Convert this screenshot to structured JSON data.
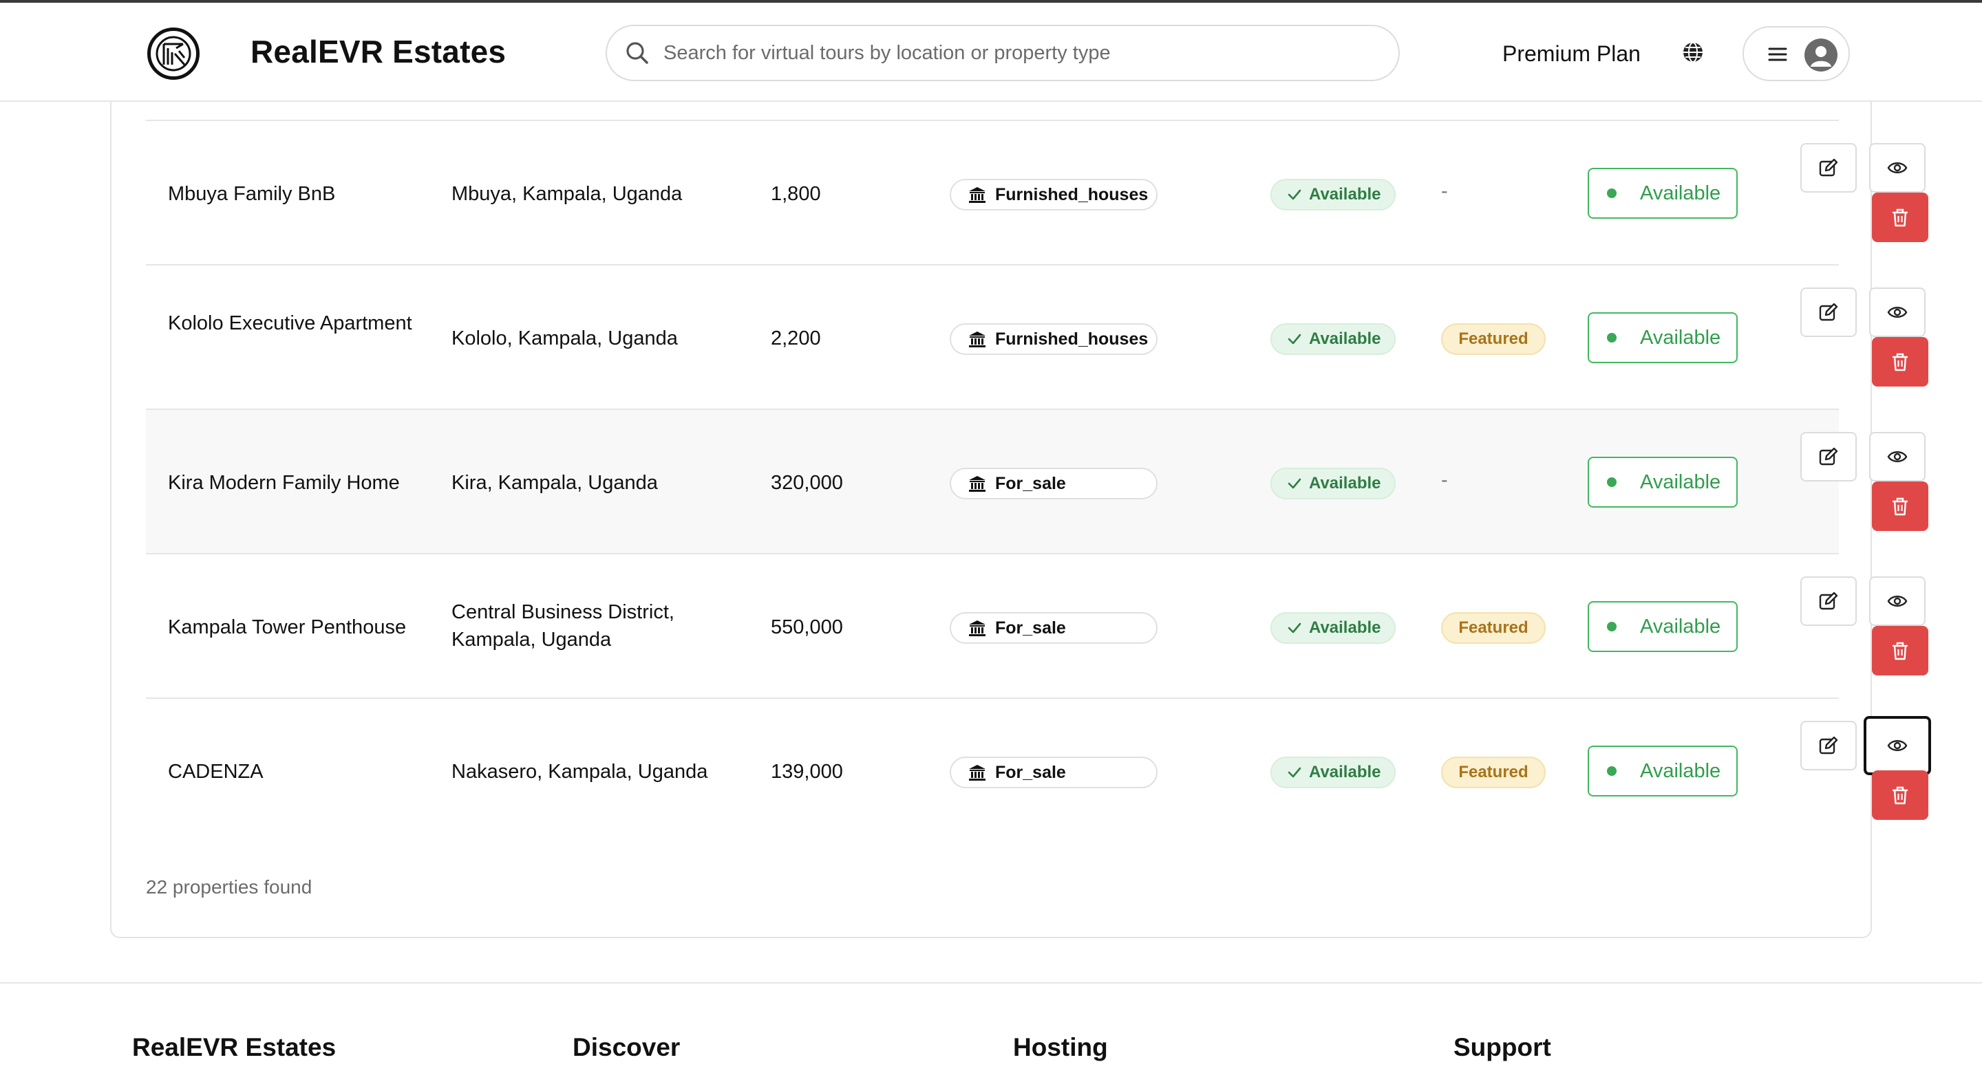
{
  "app": {
    "brand": "RealEVR Estates",
    "search_placeholder": "Search for virtual tours by location or property type",
    "plan_label": "Premium Plan"
  },
  "properties": [
    {
      "name": "Mbuya Family BnB",
      "location": "Mbuya, Kampala, Uganda",
      "price": "1,800",
      "type": "Furnished_houses",
      "availability": "Available",
      "featured": "-",
      "status": "Available"
    },
    {
      "name": "Kololo Executive Apartment",
      "location": "Kololo, Kampala, Uganda",
      "price": "2,200",
      "type": "Furnished_houses",
      "availability": "Available",
      "featured": "Featured",
      "status": "Available"
    },
    {
      "name": "Kira Modern Family Home",
      "location": "Kira, Kampala, Uganda",
      "price": "320,000",
      "type": "For_sale",
      "availability": "Available",
      "featured": "-",
      "status": "Available"
    },
    {
      "name": "Kampala Tower Penthouse",
      "location": "Central Business District, Kampala, Uganda",
      "price": "550,000",
      "type": "For_sale",
      "availability": "Available",
      "featured": "Featured",
      "status": "Available"
    },
    {
      "name": "CADENZA",
      "location": "Nakasero, Kampala, Uganda",
      "price": "139,000",
      "type": "For_sale",
      "availability": "Available",
      "featured": "Featured",
      "status": "Available"
    }
  ],
  "results_count": "22 properties found",
  "footer": {
    "columns": [
      "RealEVR Estates",
      "Discover",
      "Hosting",
      "Support"
    ]
  },
  "colors": {
    "available_green": "#2f9e4c",
    "featured_amber": "#a8731a",
    "delete_red": "#e04848"
  }
}
